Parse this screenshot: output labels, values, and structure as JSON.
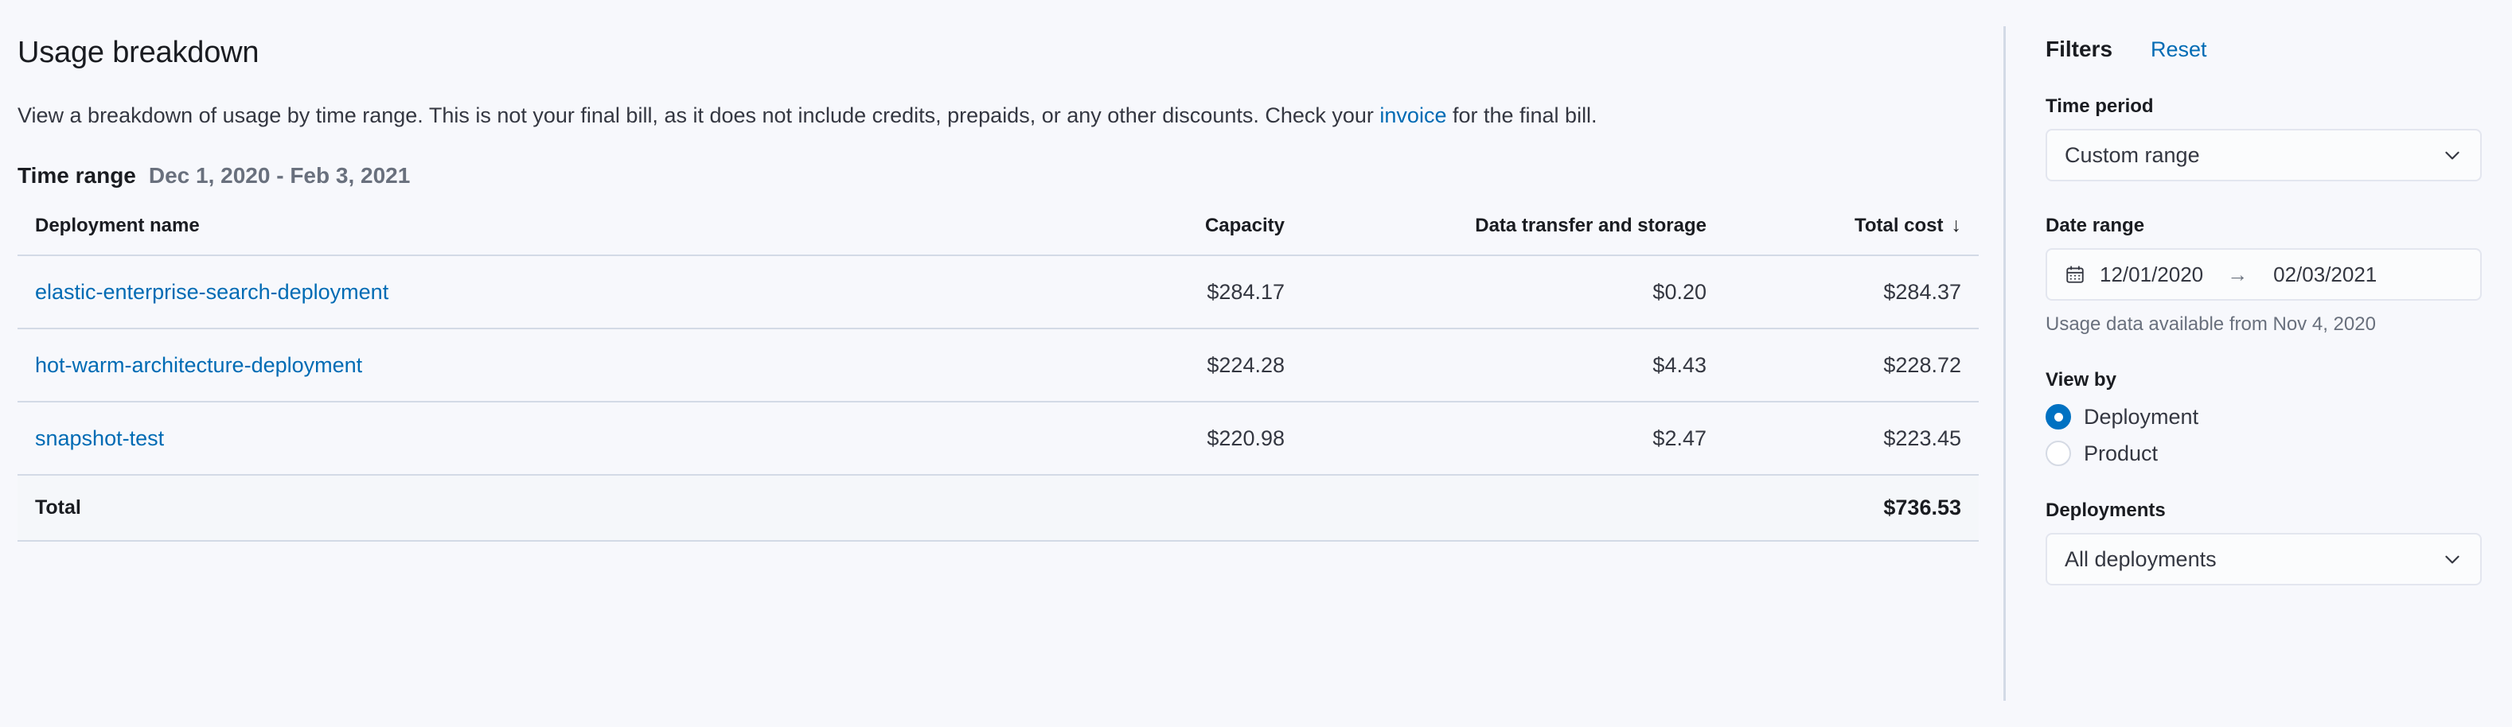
{
  "page": {
    "title": "Usage breakdown",
    "description_before_link": "View a breakdown of usage by time range. This is not your final bill, as it does not include credits, prepaids, or any other discounts. Check your ",
    "description_link": "invoice",
    "description_after_link": " for the final bill."
  },
  "time_range": {
    "label": "Time range",
    "value": "Dec 1, 2020 - Feb 3, 2021"
  },
  "table": {
    "headers": {
      "name": "Deployment name",
      "capacity": "Capacity",
      "data_transfer": "Data transfer and storage",
      "total_cost": "Total cost"
    },
    "sort_icon": "↓",
    "rows": [
      {
        "name": "elastic-enterprise-search-deployment",
        "capacity": "$284.17",
        "data_transfer": "$0.20",
        "total_cost": "$284.37"
      },
      {
        "name": "hot-warm-architecture-deployment",
        "capacity": "$224.28",
        "data_transfer": "$4.43",
        "total_cost": "$228.72"
      },
      {
        "name": "snapshot-test",
        "capacity": "$220.98",
        "data_transfer": "$2.47",
        "total_cost": "$223.45"
      }
    ],
    "total": {
      "label": "Total",
      "capacity": "",
      "data_transfer": "",
      "total_cost": "$736.53"
    }
  },
  "filters": {
    "title": "Filters",
    "reset_label": "Reset",
    "time_period": {
      "label": "Time period",
      "value": "Custom range",
      "icon": "chevron-down-icon"
    },
    "date_range": {
      "label": "Date range",
      "icon": "calendar-icon",
      "start": "12/01/2020",
      "arrow": "→",
      "end": "02/03/2021",
      "help": "Usage data available from Nov 4, 2020"
    },
    "view_by": {
      "label": "View by",
      "options": [
        {
          "label": "Deployment",
          "selected": true
        },
        {
          "label": "Product",
          "selected": false
        }
      ]
    },
    "deployments": {
      "label": "Deployments",
      "value": "All deployments",
      "icon": "chevron-down-icon"
    }
  },
  "colors": {
    "link": "#006BB4",
    "accent": "#0071C2",
    "background": "#F7F8FC",
    "border": "#D3DAE6",
    "muted_text": "#69707D"
  }
}
